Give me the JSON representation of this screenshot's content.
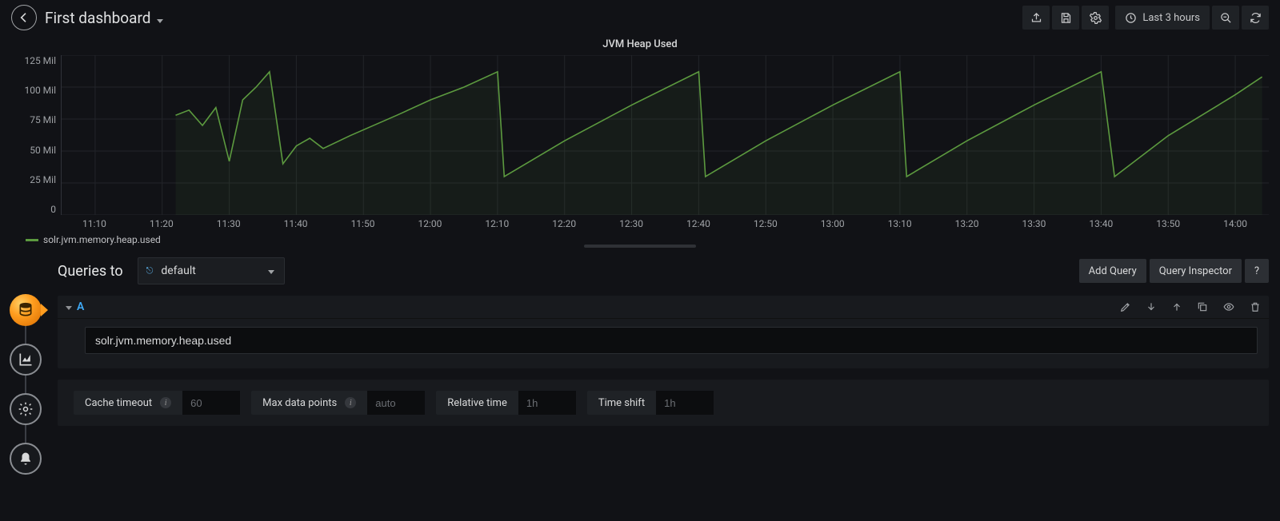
{
  "header": {
    "title": "First dashboard",
    "time_range_label": "Last 3 hours"
  },
  "panel": {
    "title": "JVM Heap Used",
    "legend_series": "solr.jvm.memory.heap.used"
  },
  "chart_data": {
    "type": "line",
    "title": "JVM Heap Used",
    "xlabel": "",
    "ylabel": "",
    "ylim": [
      0,
      125
    ],
    "y_unit": "Mil",
    "y_ticks": [
      "125 Mil",
      "100 Mil",
      "75 Mil",
      "50 Mil",
      "25 Mil",
      "0"
    ],
    "x_ticks": [
      "11:10",
      "11:20",
      "11:30",
      "11:40",
      "11:50",
      "12:00",
      "12:10",
      "12:20",
      "12:30",
      "12:40",
      "12:50",
      "13:00",
      "13:10",
      "13:20",
      "13:30",
      "13:40",
      "13:50",
      "14:00"
    ],
    "series": [
      {
        "name": "solr.jvm.memory.heap.used",
        "color": "#5c9a3f",
        "x": [
          "11:22",
          "11:24",
          "11:26",
          "11:28",
          "11:30",
          "11:32",
          "11:34",
          "11:36",
          "11:38",
          "11:40",
          "11:42",
          "11:44",
          "11:48",
          "11:55",
          "12:00",
          "12:05",
          "12:10",
          "12:11",
          "12:20",
          "12:30",
          "12:40",
          "12:41",
          "12:50",
          "13:00",
          "13:10",
          "13:11",
          "13:20",
          "13:30",
          "13:40",
          "13:42",
          "13:50",
          "14:00",
          "14:04"
        ],
        "y": [
          78,
          82,
          70,
          84,
          42,
          90,
          100,
          112,
          40,
          54,
          60,
          52,
          62,
          78,
          90,
          100,
          112,
          30,
          58,
          86,
          112,
          30,
          58,
          86,
          112,
          30,
          58,
          86,
          112,
          30,
          62,
          94,
          108
        ]
      }
    ]
  },
  "editor": {
    "queries_to_label": "Queries to",
    "datasource": "default",
    "add_query_label": "Add Query",
    "query_inspector_label": "Query Inspector",
    "query_letter": "A",
    "query_text": "solr.jvm.memory.heap.used",
    "options": {
      "cache_timeout_label": "Cache timeout",
      "cache_timeout_placeholder": "60",
      "max_data_points_label": "Max data points",
      "max_data_points_placeholder": "auto",
      "relative_time_label": "Relative time",
      "relative_time_placeholder": "1h",
      "time_shift_label": "Time shift",
      "time_shift_placeholder": "1h"
    }
  }
}
